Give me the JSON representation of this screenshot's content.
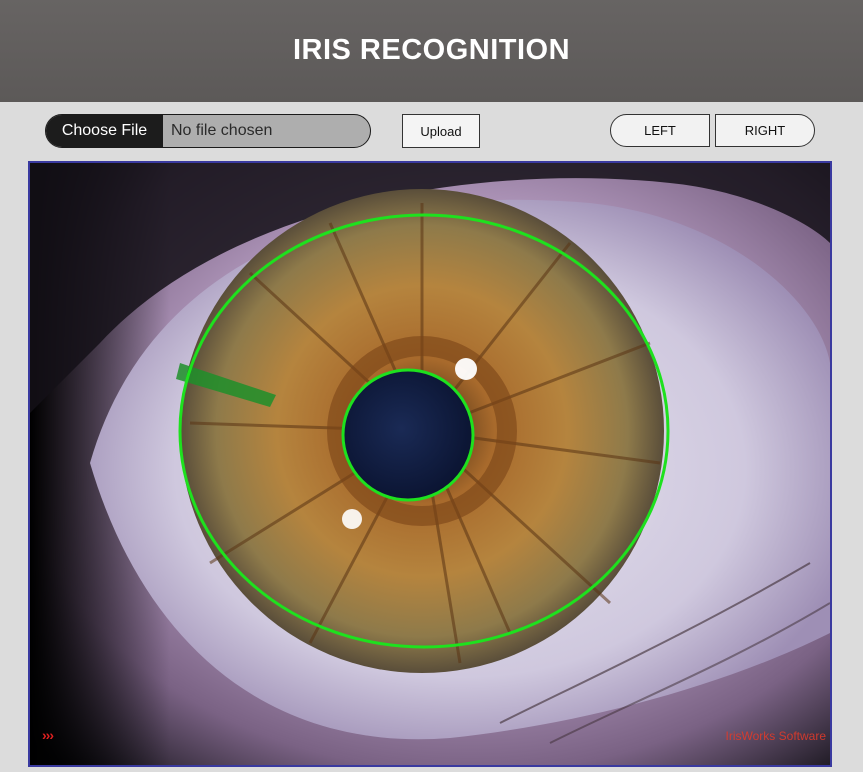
{
  "header": {
    "title": "IRIS RECOGNITION"
  },
  "toolbar": {
    "choose_file_label": "Choose File",
    "file_status": "No file chosen",
    "upload_label": "Upload",
    "left_label": "LEFT",
    "right_label": "RIGHT"
  },
  "viewer": {
    "image_content": "eye-iris-photo",
    "overlay_color": "#1ee11e",
    "watermark_text": "IrisWorks Software",
    "arrows_text": "›››"
  },
  "colors": {
    "header_bg": "#5f5c5b",
    "toolbar_bg": "#dcdcdc",
    "file_button_bg": "#1c1c1c",
    "frame_border": "#3a3aa0"
  }
}
